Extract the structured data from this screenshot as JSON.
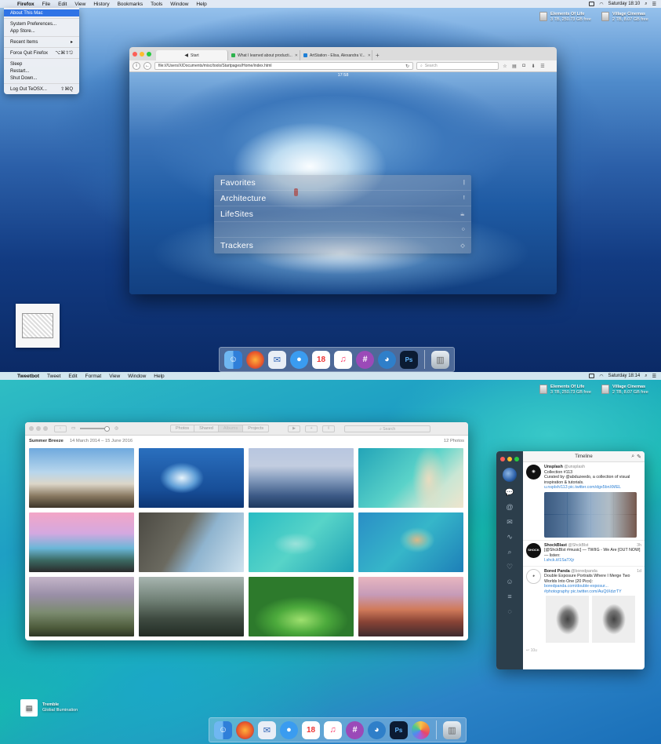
{
  "top_screen": {
    "menubar": {
      "items": [
        "Firefox",
        "File",
        "Edit",
        "View",
        "History",
        "Bookmarks",
        "Tools",
        "Window",
        "Help"
      ],
      "clock": "Saturday 18:10"
    },
    "apple_menu": {
      "items": [
        {
          "label": "About This Mac",
          "shortcut": "",
          "selected": true
        },
        {
          "label": "System Preferences...",
          "shortcut": ""
        },
        {
          "label": "App Store...",
          "shortcut": ""
        },
        {
          "label": "Recent Items",
          "shortcut": "▸"
        },
        {
          "label": "Force Quit Firefox",
          "shortcut": "⌥⌘⇧⎋"
        },
        {
          "label": "Sleep",
          "shortcut": ""
        },
        {
          "label": "Restart...",
          "shortcut": ""
        },
        {
          "label": "Shut Down...",
          "shortcut": ""
        },
        {
          "label": "Log Out TeOSX...",
          "shortcut": "⇧⌘Q"
        }
      ]
    },
    "drives": [
      {
        "name": "Elements Of Life",
        "info": "3 TB, 250.73 GB free"
      },
      {
        "name": "Village Cinemas",
        "info": "2 TB, 8.07 GB free"
      }
    ],
    "firefox": {
      "tabs": [
        {
          "title": "Start",
          "active": true
        },
        {
          "title": "What I learned about producti...",
          "active": false
        },
        {
          "title": "ArtStation - Elisa, Alexandra V...",
          "active": false
        }
      ],
      "url": "file:///Users/X/Documents/misc/tools/Startpages/Home/index.html",
      "search_placeholder": "Search",
      "page_time": "17:58",
      "startpage_items": [
        {
          "label": "Favorites",
          "icon": "|"
        },
        {
          "label": "Architecture",
          "icon": "!"
        },
        {
          "label": "LifeSites",
          "icon": "☕"
        },
        {
          "label": "",
          "icon": "○"
        },
        {
          "label": "Trackers",
          "icon": "◇"
        }
      ]
    }
  },
  "bottom_screen": {
    "menubar": {
      "items": [
        "Tweetbot",
        "Tweet",
        "Edit",
        "Format",
        "View",
        "Window",
        "Help"
      ],
      "clock": "Saturday 18:14"
    },
    "drives": [
      {
        "name": "Elements Of Life",
        "info": "3 TB, 250.73 GB free"
      },
      {
        "name": "Village Cinemas",
        "info": "2 TB, 8.07 GB free"
      }
    ],
    "photos": {
      "tabs": [
        "Photos",
        "Shared",
        "Albums",
        "Projects"
      ],
      "active_tab": "Albums",
      "search_placeholder": "Search",
      "album_title": "Summer Breeze",
      "album_dates": "14 March 2014 – 15 June 2016",
      "album_count": "12 Photos"
    },
    "tweetbot": {
      "title": "Timeline",
      "tweets": [
        {
          "name": "Unsplash",
          "handle": "@unsplash",
          "time": "",
          "lines": [
            "Collection #113",
            "Curated by @abduzeedo, a collection of visual inspiration & tutorials."
          ],
          "links": [
            "u.nsplsh/113 pic.twitter.com/dgx5bnXMEL"
          ]
        },
        {
          "name": "ShockBlast",
          "handle": "@ShckBlst",
          "time": "3h",
          "lines": [
            "[@ShckBlst #music] — TWIIG - We Are [OUT NOW] — listen:"
          ],
          "links": [
            "l.shck.it/1SaTXjr"
          ]
        },
        {
          "name": "Bored Panda",
          "handle": "@boredpanda",
          "time": "1d",
          "lines": [
            "Double Exposure Portraits Where I Merge Two Worlds Into One (20 Pics):"
          ],
          "links": [
            "boredpanda.com/double-exposur...",
            "#photography pic.twitter.com/AuQtXdzrTY"
          ]
        }
      ],
      "footer_count": "10u"
    },
    "desktop_file": {
      "name": "Tremble",
      "sub": "Global Illumination"
    }
  },
  "colors": {
    "accent": "#2f73e6",
    "close": "#fc5f57",
    "minimize": "#fdbc2e",
    "zoom": "#28c940",
    "tweetbot_sidebar": "#2c3e4b"
  }
}
